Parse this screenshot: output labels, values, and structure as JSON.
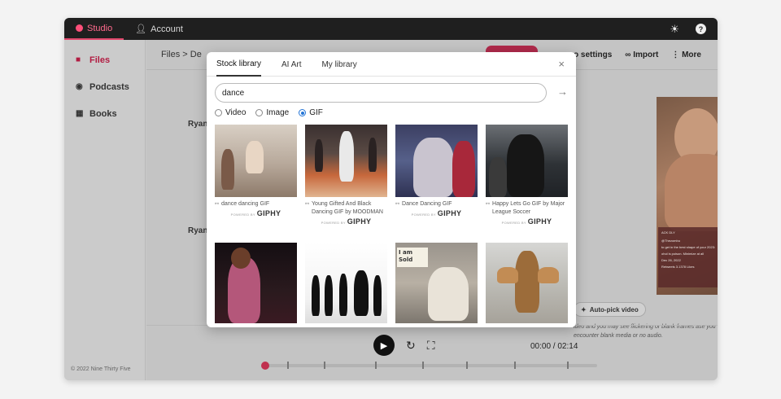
{
  "topbar": {
    "tabs": [
      {
        "label": "Studio",
        "active": true
      },
      {
        "label": "Account",
        "active": false
      }
    ],
    "icons": [
      "sun-icon",
      "help-icon"
    ]
  },
  "sidebar": {
    "items": [
      {
        "label": "Files",
        "icon": "file-icon",
        "active": true
      },
      {
        "label": "Podcasts",
        "icon": "podcast-icon",
        "active": false
      },
      {
        "label": "Books",
        "icon": "book-icon",
        "active": false
      }
    ],
    "footer": "© 2022 Nine Thirty Five"
  },
  "toolbar": {
    "breadcrumb": "Files  >  De",
    "settings_label": "o settings",
    "import_label": "Import",
    "more_label": "More"
  },
  "rows": {
    "r1": "Ryan",
    "r2": "Ryan"
  },
  "preview": {
    "tweet_line1": "ACK DLY",
    "tweet_line2": "@Thezombu",
    "tweet_line3": "to get in the best shape of your 2023:",
    "tweet_line4": "ohol is poison. Minimize at all",
    "tweet_line5": "Dec 26, 2022",
    "tweet_line6": "Retweets  3.1378 Likes",
    "autopick_label": "Auto-pick video",
    "warning": "ideo and you may see flickering or blank frames ase you encounter blank media or no audio."
  },
  "player": {
    "time": "00:00 / 02:14",
    "accent": "#c0304f"
  },
  "modal": {
    "tabs": [
      {
        "label": "Stock library",
        "active": true
      },
      {
        "label": "AI Art",
        "active": false
      },
      {
        "label": "My library",
        "active": false
      }
    ],
    "close_label": "×",
    "search_value": "dance",
    "types": [
      {
        "label": "Video",
        "checked": false
      },
      {
        "label": "Image",
        "checked": false
      },
      {
        "label": "GIF",
        "checked": true
      }
    ],
    "powered_by": "POWERED BY",
    "giphy": "GIPHY",
    "results": [
      {
        "caption": "dance dancing GIF"
      },
      {
        "caption": "Young Gifted And Black Dancing GIF by MOODMAN"
      },
      {
        "caption": "Dance Dancing GIF"
      },
      {
        "caption": "Happy Lets Go GIF by Major League Soccer"
      }
    ],
    "sold_sign": "I am Sold"
  }
}
